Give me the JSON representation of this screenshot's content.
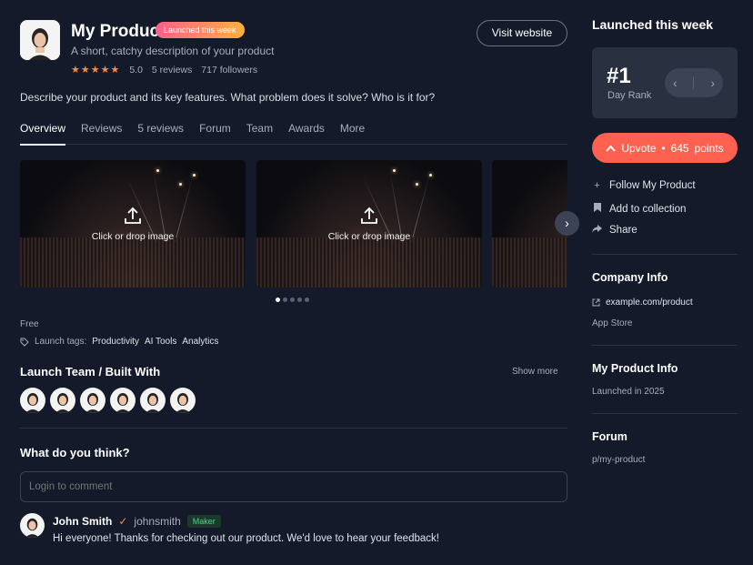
{
  "product": {
    "name": "My Product",
    "badge": "Launched this week",
    "tagline": "A short, catchy description of your product",
    "stars": "★★★★★",
    "rating": "5.0",
    "reviews": "5 reviews",
    "followers": "717 followers",
    "visit_label": "Visit website",
    "description": "Describe your product and its key features. What problem does it solve? Who is it for?"
  },
  "tabs": [
    "Overview",
    "Reviews",
    "5 reviews",
    "Forum",
    "Team",
    "Awards",
    "More"
  ],
  "gallery": {
    "upload_label": "Click or drop image",
    "next_icon": "chevron-right-icon",
    "dot_count": 5,
    "active_dot": 0
  },
  "pricing": "Free",
  "launch_tags": {
    "label": "Launch tags:",
    "items": [
      "Productivity",
      "AI Tools",
      "Analytics"
    ]
  },
  "team": {
    "title": "Launch Team / Built With",
    "show_more": "Show more",
    "member_count": 6
  },
  "comments": {
    "title": "What do you think?",
    "placeholder": "Login to comment",
    "items": [
      {
        "name": "John Smith",
        "verified": "✓",
        "handle": "johnsmith",
        "role": "Maker",
        "text": "Hi everyone! Thanks for checking out our product. We'd love to hear your feedback!"
      }
    ]
  },
  "sidebar": {
    "title": "Launched this week",
    "rank": "#1",
    "rank_label": "Day Rank",
    "upvote_label": "Upvote",
    "upvote_separator": "•",
    "upvote_count": "645",
    "upvote_suffix": "points",
    "actions": [
      {
        "icon": "plus-icon",
        "label": "Follow My Product"
      },
      {
        "icon": "bookmark-icon",
        "label": "Add to collection"
      },
      {
        "icon": "share-icon",
        "label": "Share"
      }
    ],
    "company_title": "Company Info",
    "company_link": "example.com/product",
    "company_store": "App Store",
    "product_info_title": "My Product Info",
    "product_info_text": "Launched in 2025",
    "forum_title": "Forum",
    "forum_link": "p/my-product"
  },
  "colors": {
    "background": "#141a29",
    "accent": "#ff6150",
    "star": "#ff8a3d",
    "maker_green": "#4fd18b"
  }
}
